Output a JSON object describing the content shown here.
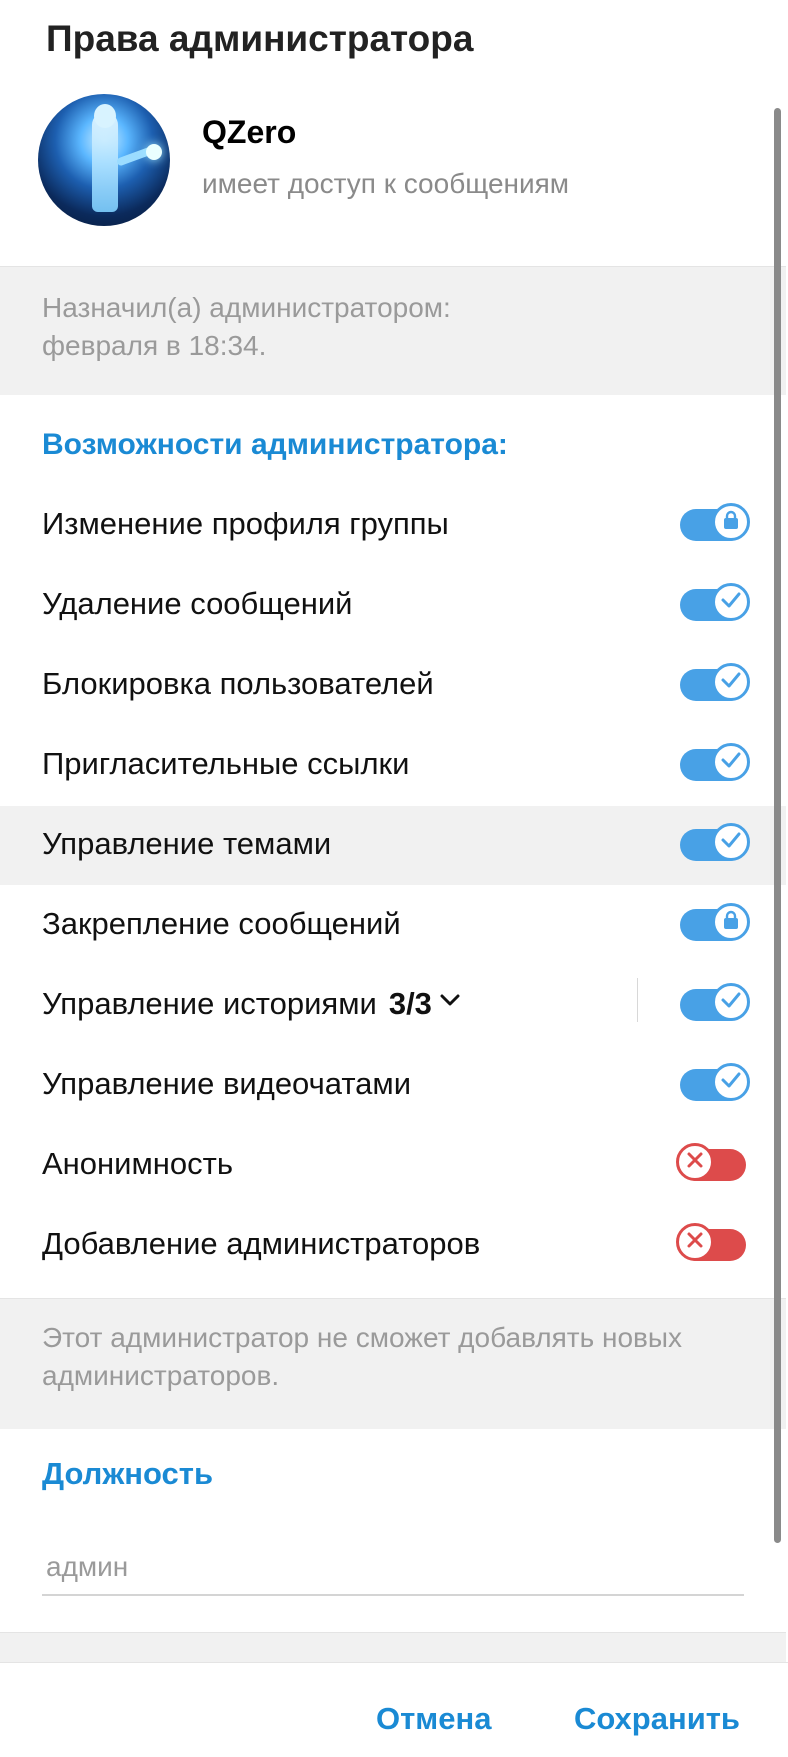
{
  "header": {
    "title": "Права администратора"
  },
  "user": {
    "name": "QZero",
    "status": "имеет доступ к сообщениям"
  },
  "assigned": {
    "line1": "Назначил(а) администратором:",
    "line2": "февраля в 18:34."
  },
  "permissions": {
    "heading": "Возможности администратора:",
    "items": [
      {
        "label": "Изменение профиля группы",
        "state": "on",
        "icon": "lock-icon"
      },
      {
        "label": "Удаление сообщений",
        "state": "on",
        "icon": "check-icon"
      },
      {
        "label": "Блокировка пользователей",
        "state": "on",
        "icon": "check-icon"
      },
      {
        "label": "Пригласительные ссылки",
        "state": "on",
        "icon": "check-icon"
      },
      {
        "label": "Управление темами",
        "state": "on",
        "icon": "check-icon"
      },
      {
        "label": "Закрепление сообщений",
        "state": "on",
        "icon": "lock-icon"
      },
      {
        "label": "Управление историями",
        "count": "3/3",
        "state": "on",
        "icon": "check-icon"
      },
      {
        "label": "Управление видеочатами",
        "state": "on",
        "icon": "check-icon"
      },
      {
        "label": "Анонимность",
        "state": "off",
        "icon": "cross-icon"
      },
      {
        "label": "Добавление администраторов",
        "state": "off",
        "icon": "cross-icon"
      }
    ]
  },
  "note": {
    "line1": "Этот администратор не сможет добавлять новых",
    "line2": "администраторов."
  },
  "rank": {
    "label": "Должность",
    "placeholder": "админ",
    "value": ""
  },
  "footer": {
    "cancel": "Отмена",
    "save": "Сохранить"
  },
  "colors": {
    "accent": "#1a8ad4",
    "toggle_on": "#48a1e6",
    "toggle_off": "#dd4b4b"
  }
}
